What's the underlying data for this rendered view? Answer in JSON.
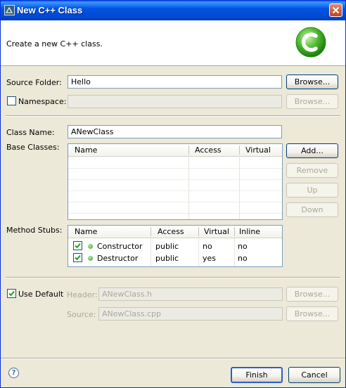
{
  "window": {
    "title": "New C++ Class"
  },
  "banner": {
    "description": "Create a new C++ class."
  },
  "source_folder": {
    "label": "Source Folder:",
    "value": "Hello",
    "browse": "Browse..."
  },
  "namespace": {
    "label": "Namespace:",
    "value": "",
    "checked": false,
    "browse": "Browse..."
  },
  "class_name": {
    "label": "Class Name:",
    "value": "ANewClass"
  },
  "base_classes": {
    "label": "Base Classes:",
    "columns": [
      "Name",
      "Access",
      "Virtual"
    ],
    "rows": [],
    "buttons": {
      "add": "Add...",
      "remove": "Remove",
      "up": "Up",
      "down": "Down"
    }
  },
  "method_stubs": {
    "label": "Method Stubs:",
    "columns": [
      "Name",
      "Access",
      "Virtual",
      "Inline"
    ],
    "rows": [
      {
        "checked": true,
        "name": "Constructor",
        "access": "public",
        "virtual": "no",
        "inline": "no"
      },
      {
        "checked": true,
        "name": "Destructor",
        "access": "public",
        "virtual": "yes",
        "inline": "no"
      }
    ]
  },
  "use_default": {
    "label": "Use Default",
    "checked": true
  },
  "header": {
    "label": "Header:",
    "value": "ANewClass.h",
    "browse": "Browse..."
  },
  "source": {
    "label": "Source:",
    "value": "ANewClass.cpp",
    "browse": "Browse..."
  },
  "footer": {
    "help": "?",
    "finish": "Finish",
    "cancel": "Cancel"
  },
  "colors": {
    "titlebar": "#0054e3",
    "dialog_bg": "#ece9d8",
    "logo": "#4cb82e"
  }
}
